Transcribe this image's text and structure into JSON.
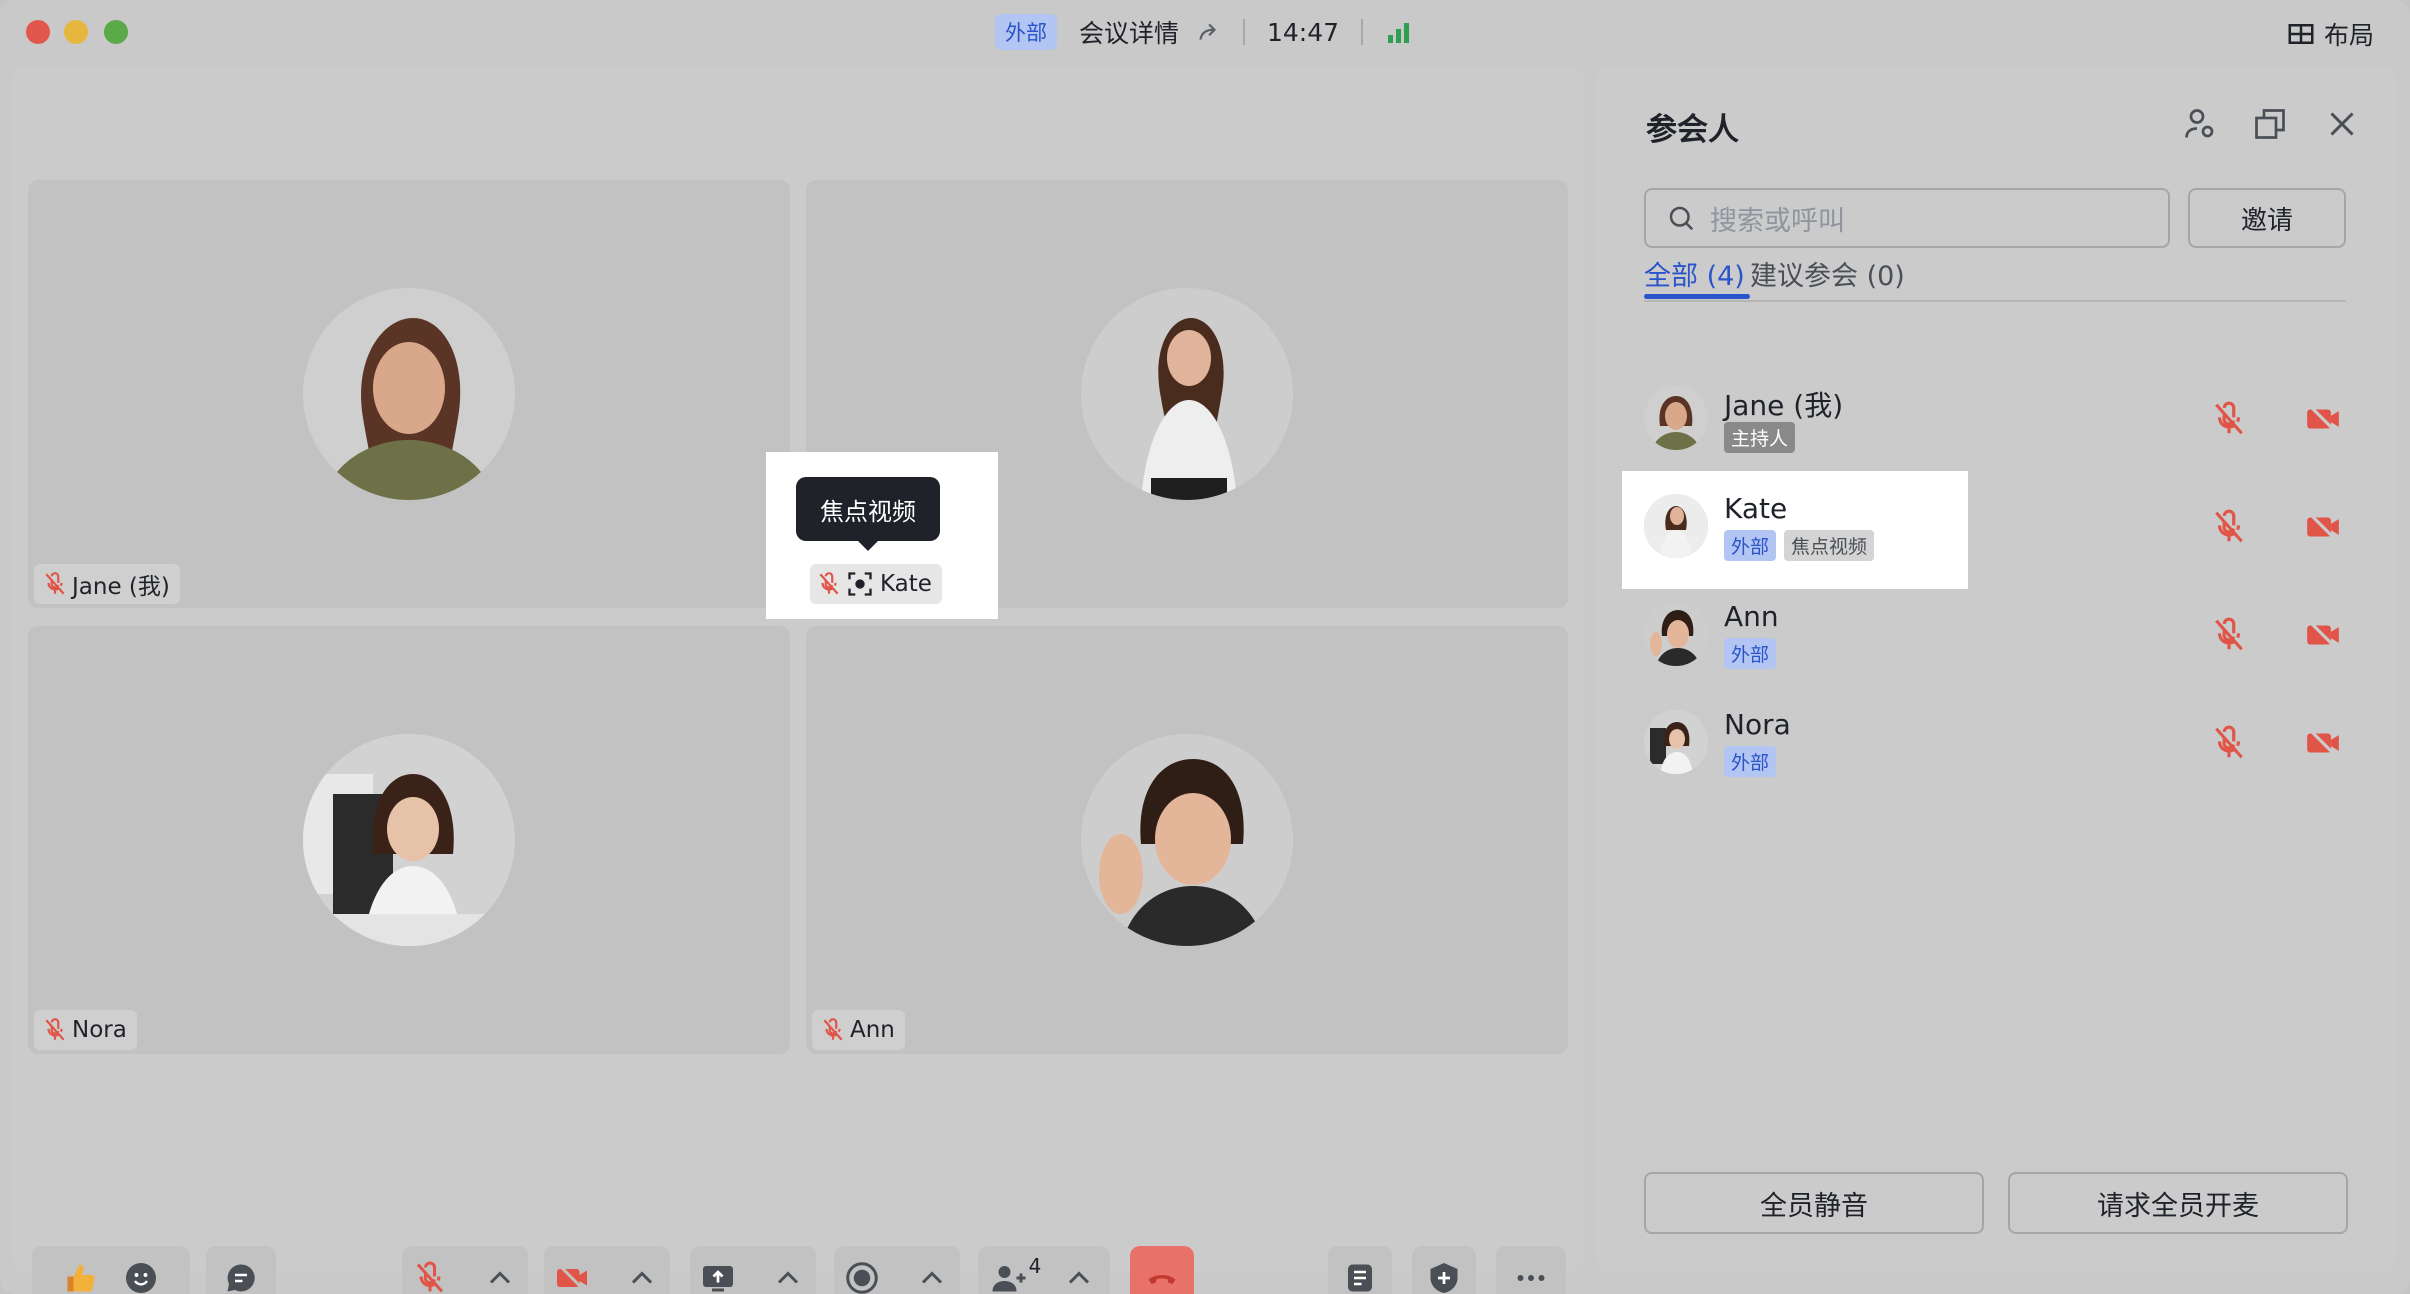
{
  "titlebar": {
    "badge": "外部",
    "meeting_details": "会议详情",
    "time": "14:47",
    "layout_label": "布局"
  },
  "tiles": [
    {
      "name": "Jane (我)"
    },
    {
      "name": "Kate"
    },
    {
      "name": "Nora"
    },
    {
      "name": "Ann"
    }
  ],
  "tooltip": {
    "text": "焦点视频"
  },
  "toolbar": {
    "participants_count": "4"
  },
  "panel": {
    "title": "参会人",
    "search_placeholder": "搜索或呼叫",
    "invite_label": "邀请",
    "tab_all": "全部 (4)",
    "tab_suggested": "建议参会 (0)",
    "participants": [
      {
        "name": "Jane (我)",
        "tags": [
          "主持人"
        ]
      },
      {
        "name": "Kate",
        "tags": [
          "外部",
          "焦点视频"
        ]
      },
      {
        "name": "Ann",
        "tags": [
          "外部"
        ]
      },
      {
        "name": "Nora",
        "tags": [
          "外部"
        ]
      }
    ],
    "mute_all_label": "全员静音",
    "request_unmute_label": "请求全员开麦"
  },
  "colors": {
    "accent": "#2a54c9",
    "danger": "#e05547",
    "hangup": "#e8726a"
  }
}
